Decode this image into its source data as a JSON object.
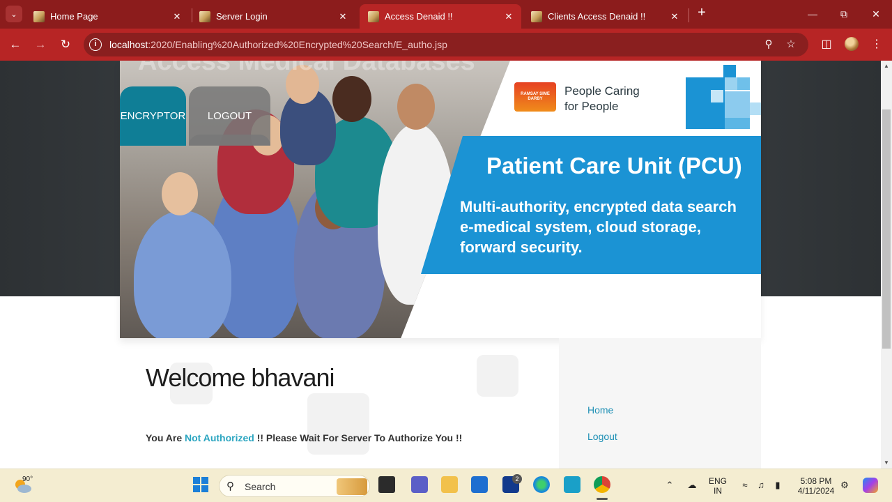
{
  "browser": {
    "tabs": [
      {
        "title": "Home Page",
        "active": false
      },
      {
        "title": "Server Login",
        "active": false
      },
      {
        "title": "Access Denaid !!",
        "active": true
      },
      {
        "title": "Clients Access Denaid !!",
        "active": false
      }
    ],
    "url_host": "localhost",
    "url_path": ":2020/Enabling%20Authorized%20Encrypted%20Search/E_autho.jsp",
    "theme_color": "#b72525"
  },
  "banner": {
    "faded_heading": "Access Medical Databases",
    "logo_text": "RAMSAY SIME DARBY",
    "tagline_line1": "People Caring",
    "tagline_line2": "for People",
    "title": "Patient Care Unit (PCU)",
    "subtitle_line1": "Multi-authority, encrypted data search",
    "subtitle_line2": "e-medical system, cloud storage,",
    "subtitle_line3": "forward security."
  },
  "nav": {
    "encryptor_label": "ENCRYPTOR",
    "logout_label": "LOGOUT"
  },
  "content": {
    "welcome": "Welcome bhavani",
    "notice_prefix": "You Are ",
    "notice_highlight": "Not Authorized",
    "notice_suffix": " !! Please Wait For Server To Authorize You !!"
  },
  "sidebar": {
    "links": [
      "Home",
      "Logout"
    ]
  },
  "taskbar": {
    "temperature": "90°",
    "search_label": "Search",
    "lang_line1": "ENG",
    "lang_line2": "IN",
    "time": "5:08 PM",
    "date": "4/11/2024",
    "notification_badge": "2"
  }
}
